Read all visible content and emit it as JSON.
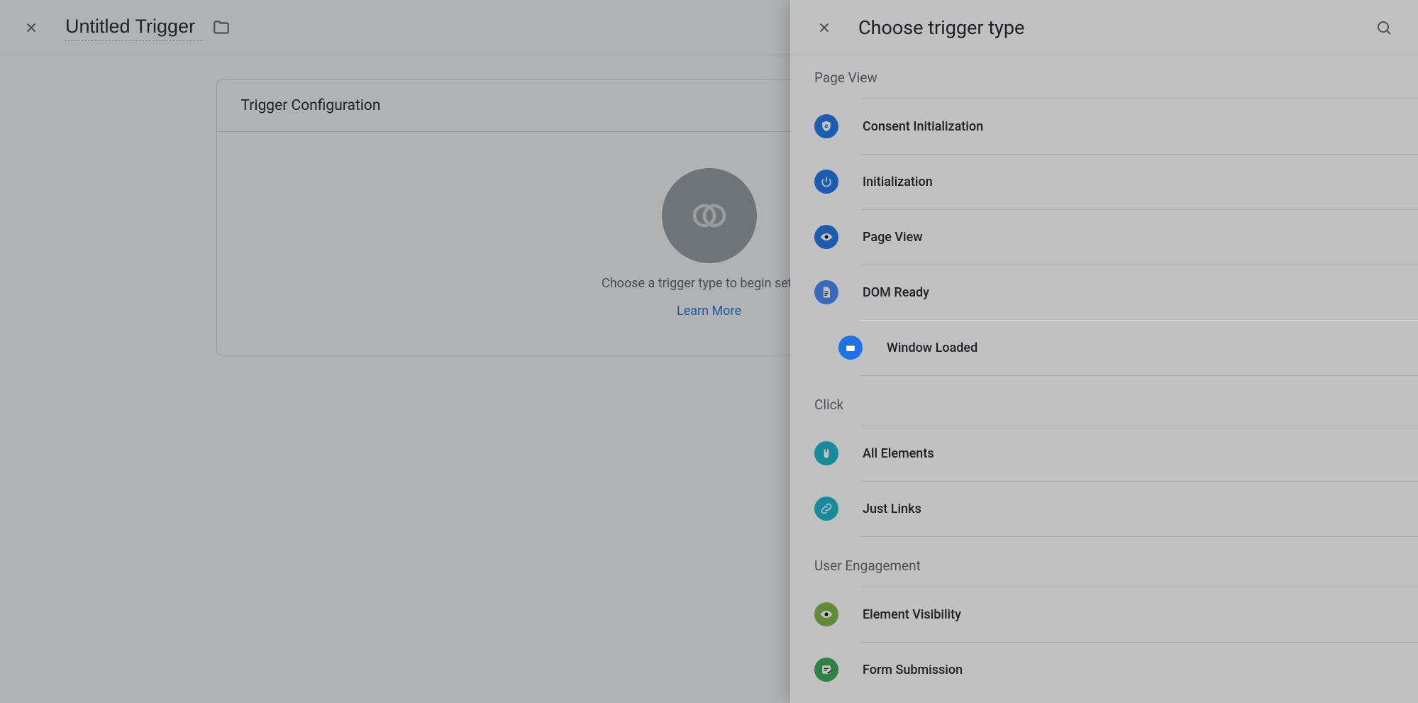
{
  "topbar": {
    "title": "Untitled Trigger"
  },
  "card": {
    "header": "Trigger Configuration",
    "placeholder": "Choose a trigger type to begin setup...",
    "learnMore": "Learn More"
  },
  "panel": {
    "title": "Choose trigger type",
    "sections": [
      {
        "label": "Page View",
        "items": [
          {
            "label": "Consent Initialization",
            "icon": "shield",
            "color": "ic-blue"
          },
          {
            "label": "Initialization",
            "icon": "power",
            "color": "ic-blue"
          },
          {
            "label": "Page View",
            "icon": "eye",
            "color": "ic-blue"
          },
          {
            "label": "DOM Ready",
            "icon": "doc",
            "color": "ic-lblue"
          },
          {
            "label": "Window Loaded",
            "icon": "window",
            "color": "ic-blue",
            "highlighted": true
          }
        ]
      },
      {
        "label": "Click",
        "items": [
          {
            "label": "All Elements",
            "icon": "mouse",
            "color": "ic-cyan"
          },
          {
            "label": "Just Links",
            "icon": "link",
            "color": "ic-cyan"
          }
        ]
      },
      {
        "label": "User Engagement",
        "items": [
          {
            "label": "Element Visibility",
            "icon": "eye",
            "color": "ic-lgreen"
          },
          {
            "label": "Form Submission",
            "icon": "form",
            "color": "ic-green"
          }
        ]
      }
    ]
  }
}
